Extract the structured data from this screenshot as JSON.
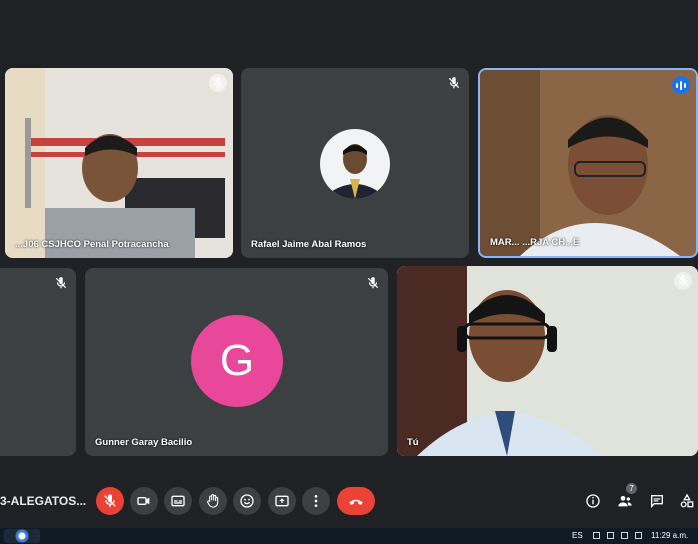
{
  "participants": [
    {
      "name": "...J06 CSJHCO Penal Potracancha",
      "kind": "video"
    },
    {
      "name": "Rafael Jaime Abal Ramos",
      "kind": "photo"
    },
    {
      "name": "MAR... ...RJA CH...E",
      "kind": "video",
      "speaking": true
    },
    {
      "name": "",
      "kind": "empty"
    },
    {
      "name": "Gunner Garay Bacilio",
      "kind": "initial",
      "initial": "G",
      "avatar_color": "#e8479a"
    },
    {
      "name": "Tú",
      "kind": "video"
    }
  ],
  "toolbar": {
    "meeting_title": "3-ALEGATOS...",
    "participant_count": "7"
  },
  "taskbar": {
    "language": "ES",
    "time": "11:29 a.m."
  },
  "colors": {
    "background": "#202124",
    "tile": "#3c4043",
    "danger": "#ea4335",
    "accent": "#1a73e8"
  },
  "icons": [
    "mic-off-icon",
    "camera-icon",
    "captions-icon",
    "hand-icon",
    "emoji-icon",
    "present-icon",
    "more-icon",
    "hangup-icon",
    "info-icon",
    "people-icon",
    "chat-icon",
    "activities-icon"
  ]
}
